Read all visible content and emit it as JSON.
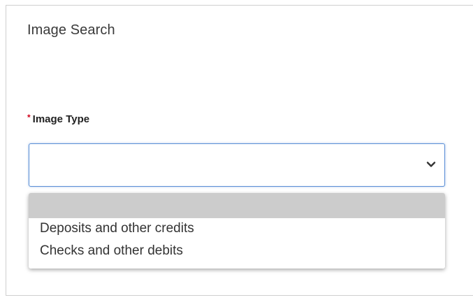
{
  "panel": {
    "title": "Image Search"
  },
  "form": {
    "image_type": {
      "required_mark": "*",
      "label": "Image Type",
      "selected_value": "",
      "chevron_icon": "chevron-down-icon",
      "options": [
        {
          "label": ""
        },
        {
          "label": "Deposits and other credits"
        },
        {
          "label": "Checks and other debits"
        }
      ]
    }
  },
  "colors": {
    "required": "#d0021b",
    "focus_border": "#5b8fd6",
    "highlight": "#cccccc"
  }
}
